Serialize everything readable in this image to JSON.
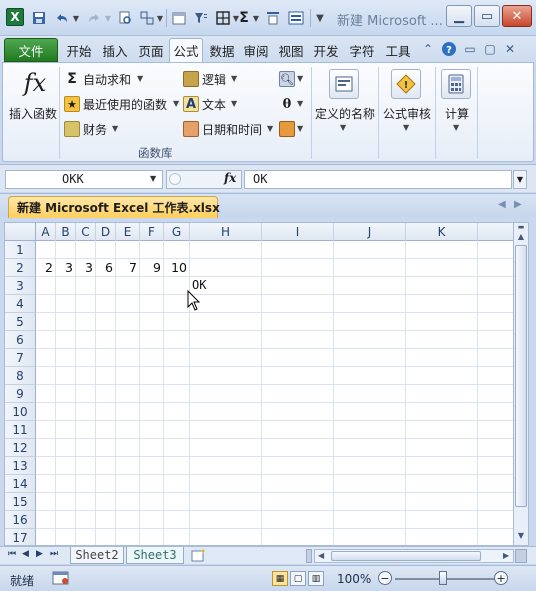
{
  "title_bar": {
    "window_title": "新建 Microsoft ...",
    "app_icon_letter": "X",
    "qat_icons": [
      "save-icon",
      "undo-icon",
      "redo-icon",
      "print-preview-icon",
      "group-icon",
      "calendar-icon",
      "filter-icon",
      "borders-icon",
      "autosum-icon",
      "format-icon",
      "more-icon"
    ],
    "sigma": "Σ"
  },
  "tabs": [
    {
      "label": "文件"
    },
    {
      "label": "开始"
    },
    {
      "label": "插入"
    },
    {
      "label": "页面"
    },
    {
      "label": "公式"
    },
    {
      "label": "数据"
    },
    {
      "label": "审阅"
    },
    {
      "label": "视图"
    },
    {
      "label": "开发"
    },
    {
      "label": "字符"
    },
    {
      "label": "工具"
    }
  ],
  "ribbon": {
    "insert_function": "插入函数",
    "fx_glyph": "fx",
    "autosum": "自动求和",
    "recently_used": "最近使用的函数",
    "financial": "财务",
    "logical": "逻辑",
    "text": "文本",
    "date_time": "日期和时间",
    "define_names": "定义的名称",
    "formula_auditing": "公式审核",
    "calculation": "计算",
    "group_label": "函数库"
  },
  "formula_bar": {
    "name_box": "OKK",
    "fx_label": "fx",
    "formula": "OK"
  },
  "workbook": {
    "tab_title": "新建 Microsoft Excel 工作表.xlsx"
  },
  "grid": {
    "columns": [
      "A",
      "B",
      "C",
      "D",
      "E",
      "F",
      "G",
      "H",
      "I",
      "J",
      "K"
    ],
    "rows": [
      "1",
      "2",
      "3",
      "4",
      "5",
      "6",
      "7",
      "8",
      "9",
      "10",
      "11",
      "12",
      "13",
      "14",
      "15",
      "16",
      "17"
    ],
    "row2_values": [
      "2",
      "3",
      "3",
      "6",
      "7",
      "9",
      "10"
    ],
    "h3_value": "OK"
  },
  "sheets": [
    {
      "label": "Sheet2"
    },
    {
      "label": "Sheet3"
    }
  ],
  "status": {
    "ready": "就绪",
    "zoom": "100%"
  }
}
